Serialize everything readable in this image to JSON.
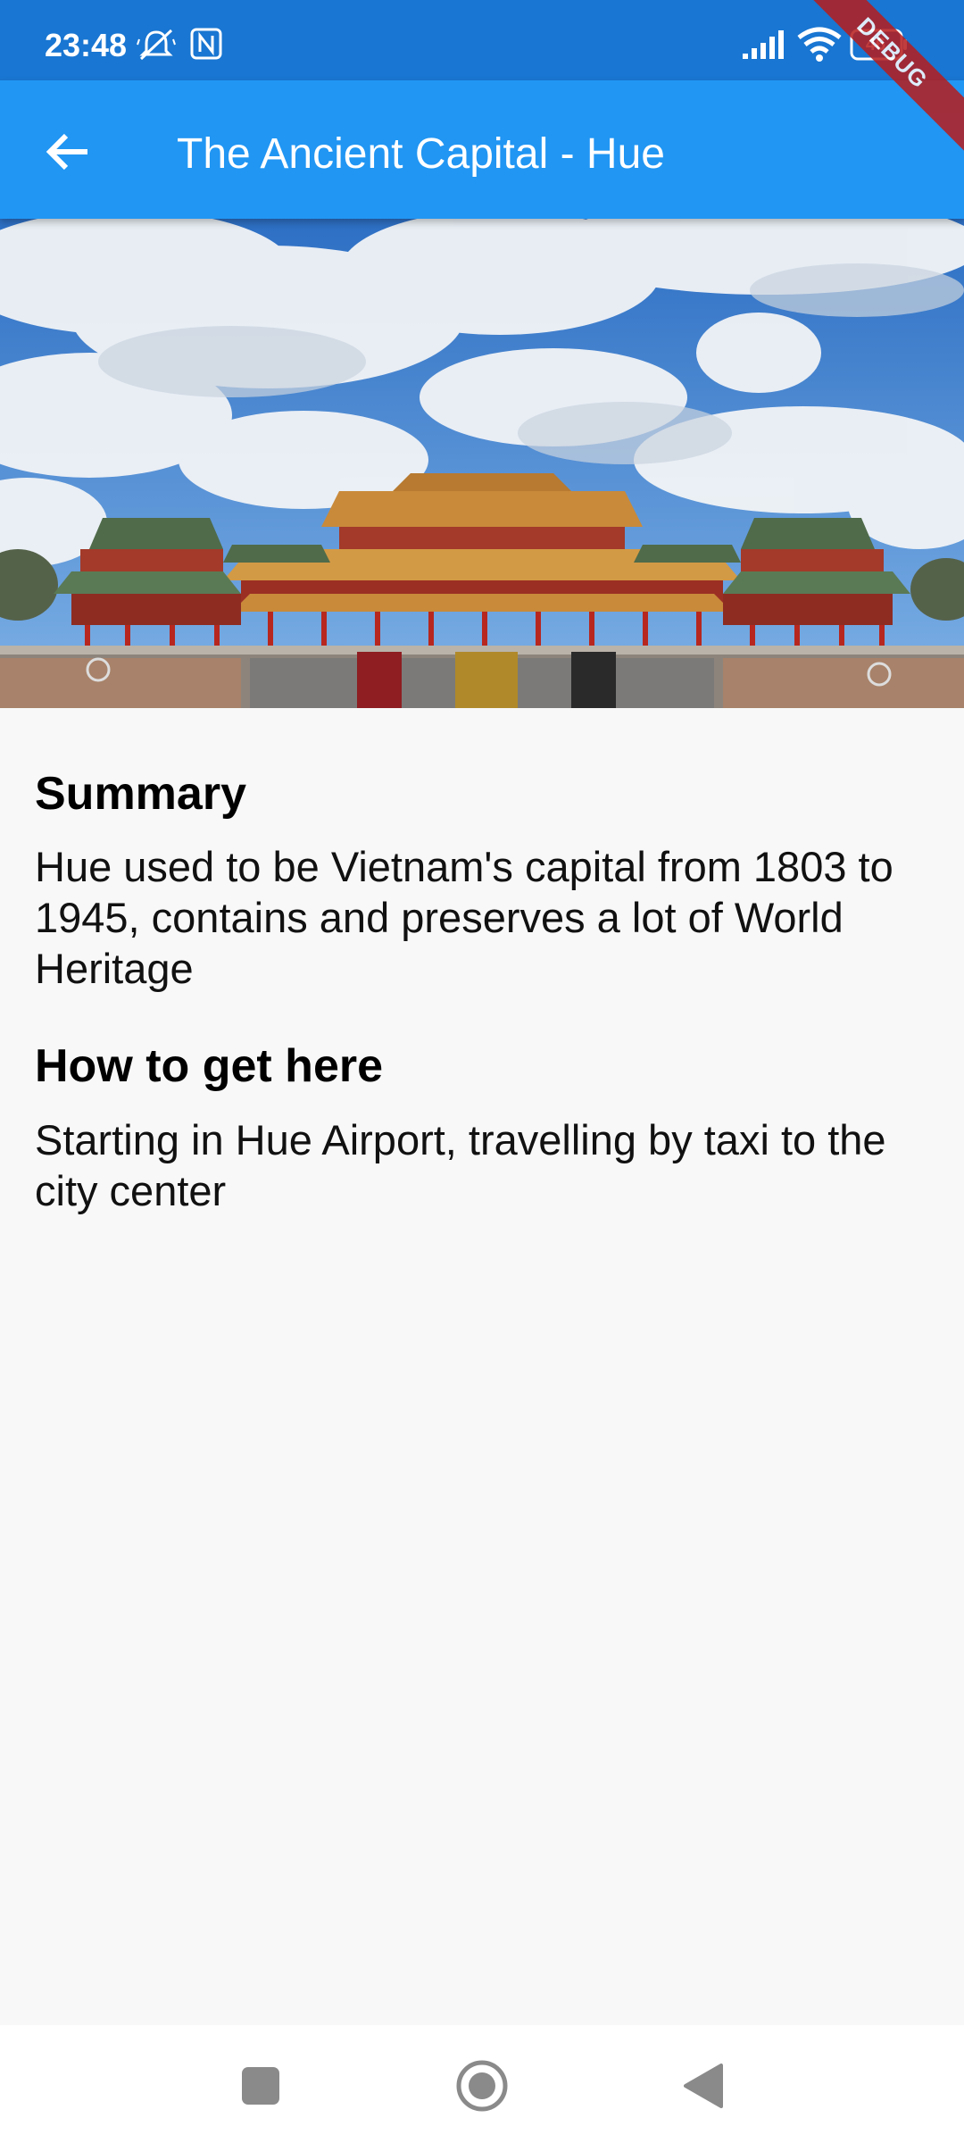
{
  "status_bar": {
    "time": "23:48",
    "battery": "46",
    "icons": [
      "muted-bell-icon",
      "nfc-icon",
      "signal-icon",
      "wifi-icon",
      "battery-icon"
    ]
  },
  "debug_banner": "DEBUG",
  "app_bar": {
    "title": "The Ancient Capital - Hue",
    "back_icon": "arrow-back-icon",
    "color": "#2196f3"
  },
  "hero_image": {
    "subject": "imperial-citadel-gate-photo"
  },
  "sections": [
    {
      "title": "Summary",
      "body": "Hue used to be Vietnam's capital from 1803 to 1945, contains and preserves a lot of World Heritage"
    },
    {
      "title": "How to get here",
      "body": "Starting in Hue Airport, travelling by taxi to the city center"
    }
  ],
  "nav_bar": {
    "icons": [
      "recents-square-icon",
      "home-circle-icon",
      "back-triangle-icon"
    ]
  }
}
